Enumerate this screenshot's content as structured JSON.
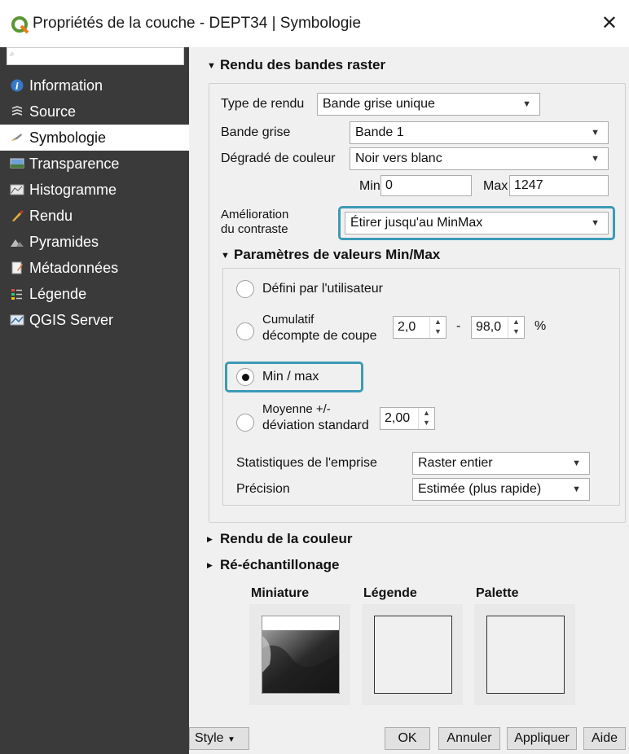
{
  "window": {
    "title": "Propriétés de la couche - DEPT34 | Symbologie",
    "close": "✕"
  },
  "sidebar": {
    "search_placeholder": "",
    "items": [
      {
        "label": "Information",
        "icon": "info-icon"
      },
      {
        "label": "Source",
        "icon": "source-icon"
      },
      {
        "label": "Symbologie",
        "icon": "symbology-icon",
        "active": true
      },
      {
        "label": "Transparence",
        "icon": "transparency-icon"
      },
      {
        "label": "Histogramme",
        "icon": "histogram-icon"
      },
      {
        "label": "Rendu",
        "icon": "render-icon"
      },
      {
        "label": "Pyramides",
        "icon": "pyramids-icon"
      },
      {
        "label": "Métadonnées",
        "icon": "metadata-icon"
      },
      {
        "label": "Légende",
        "icon": "legend-icon"
      },
      {
        "label": "QGIS Server",
        "icon": "server-icon"
      }
    ]
  },
  "raster": {
    "section_title": "Rendu des bandes raster",
    "render_type_label": "Type de rendu",
    "render_type_value": "Bande grise unique",
    "gray_band_label": "Bande grise",
    "gray_band_value": "Bande 1",
    "gradient_label": "Dégradé de couleur",
    "gradient_value": "Noir vers blanc",
    "min_label": "Min",
    "min_value": "0",
    "max_label": "Max",
    "max_value": "1247",
    "contrast_label_1": "Amélioration",
    "contrast_label_2": "du contraste",
    "contrast_value": "Étirer jusqu'au MinMax"
  },
  "minmax": {
    "title": "Paramètres de valeurs Min/Max",
    "user_defined": "Défini par l'utilisateur",
    "cumulative_1": "Cumulatif",
    "cumulative_2": "décompte de coupe",
    "cum_low": "2,0",
    "dash": "-",
    "cum_high": "98,0",
    "percent": "%",
    "minmax_option": "Min / max",
    "mean_1": "Moyenne +/-",
    "mean_2": "déviation standard",
    "std_value": "2,00",
    "stats_label": "Statistiques de l'emprise",
    "stats_value": "Raster entier",
    "precision_label": "Précision",
    "precision_value": "Estimée (plus rapide)",
    "selected": "Min / max"
  },
  "sections": {
    "color_render": "Rendu de la couleur",
    "resampling": "Ré-échantillonage"
  },
  "preview": {
    "thumbnail": "Miniature",
    "legend": "Légende",
    "palette": "Palette"
  },
  "buttons": {
    "style": "Style",
    "ok": "OK",
    "cancel": "Annuler",
    "apply": "Appliquer",
    "help": "Aide"
  },
  "colors": {
    "sidebar_bg": "#3a3a3a",
    "highlight": "#3b9bb6",
    "qgis_green": "#589632"
  }
}
